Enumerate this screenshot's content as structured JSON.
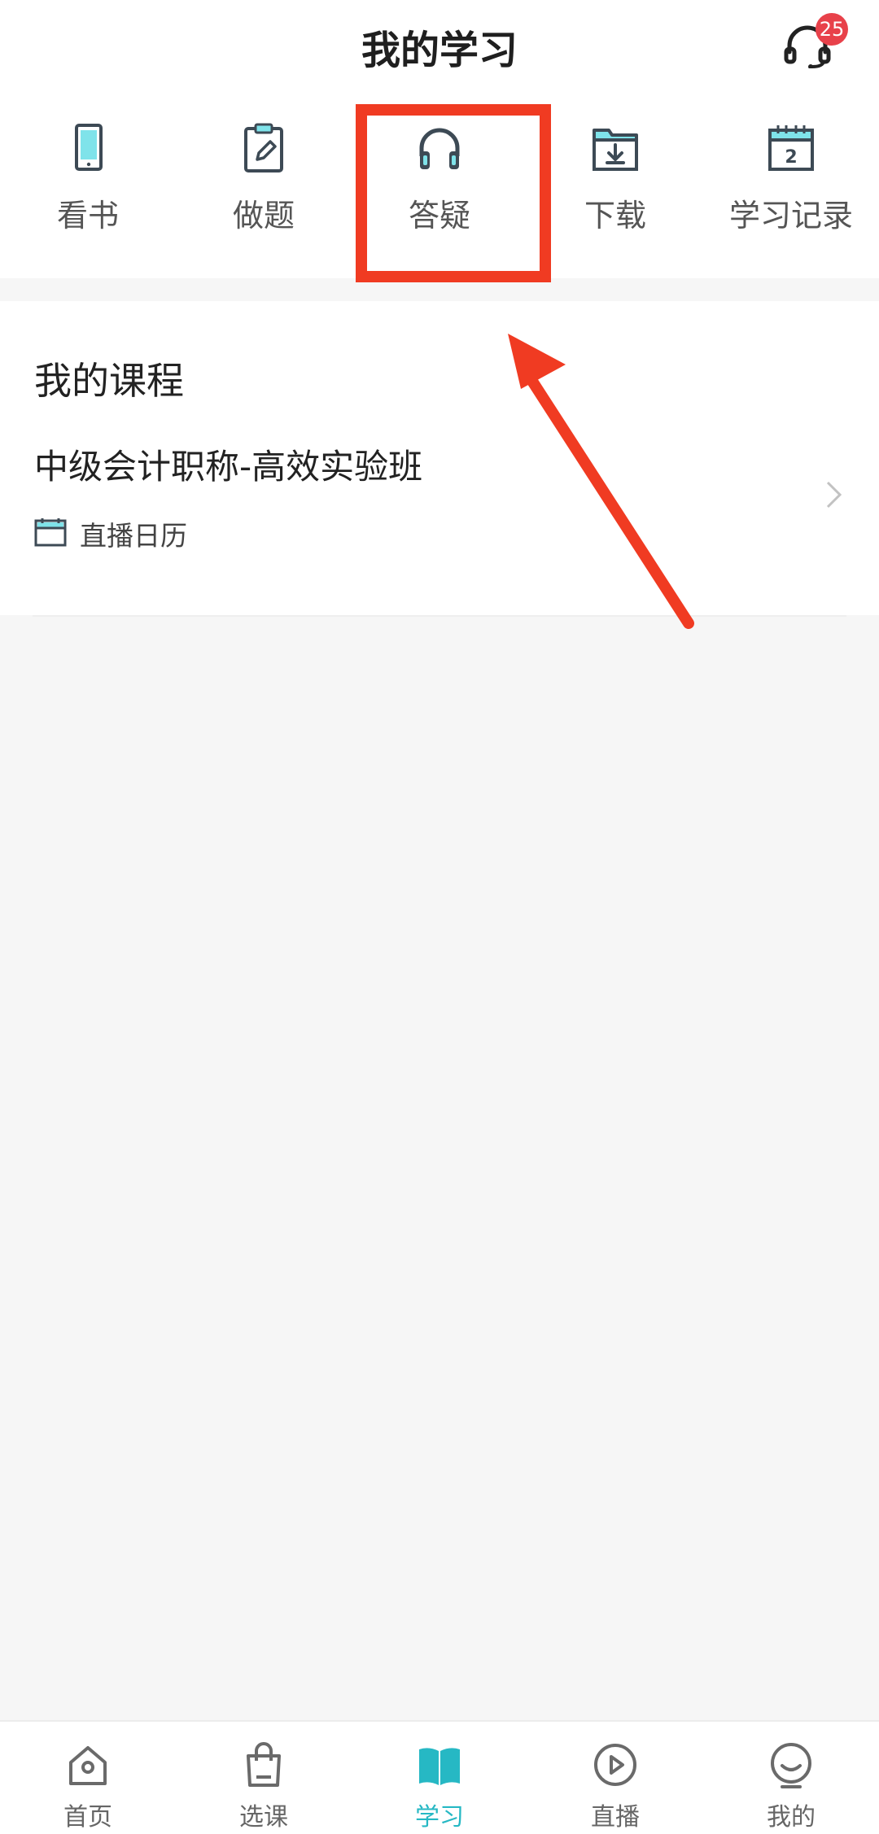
{
  "header": {
    "title": "我的学习",
    "badge_count": "25",
    "support_icon": "headset-icon"
  },
  "quick_actions": [
    {
      "label": "看书",
      "icon": "tablet-icon"
    },
    {
      "label": "做题",
      "icon": "clipboard-edit-icon"
    },
    {
      "label": "答疑",
      "icon": "headphones-icon"
    },
    {
      "label": "下载",
      "icon": "download-folder-icon"
    },
    {
      "label": "学习记录",
      "icon": "calendar-icon"
    }
  ],
  "my_courses": {
    "title": "我的课程",
    "course": {
      "name": "中级会计职称-高效实验班",
      "calendar_label": "直播日历"
    }
  },
  "tabbar": [
    {
      "label": "首页",
      "icon": "home-icon"
    },
    {
      "label": "选课",
      "icon": "shopping-bag-icon"
    },
    {
      "label": "学习",
      "icon": "open-book-icon",
      "active": true
    },
    {
      "label": "直播",
      "icon": "play-circle-icon"
    },
    {
      "label": "我的",
      "icon": "smiley-face-icon"
    }
  ],
  "colors": {
    "accent": "#26b8c4",
    "accent_light": "#7fe3ea",
    "annotation_red": "#f03b22",
    "badge_red": "#e8414a",
    "background": "#f6f6f6"
  }
}
